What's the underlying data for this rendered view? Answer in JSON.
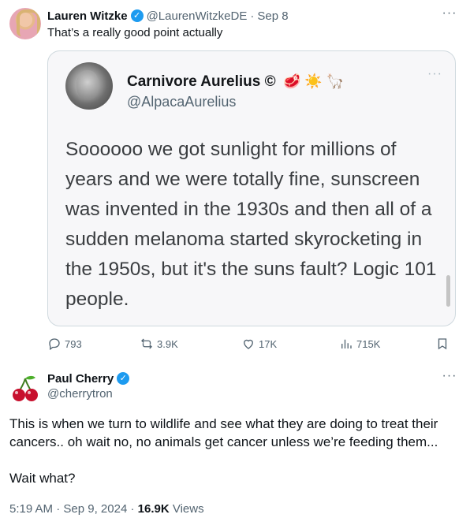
{
  "reply": {
    "author_name": "Lauren Witzke",
    "author_handle": "@LaurenWitzkeDE",
    "date": "Sep 8",
    "text": "That’s a really good point actually",
    "quote": {
      "name": "Carnivore Aurelius ©",
      "emojis": "🥩 ☀️ 🦙",
      "handle": "@AlpacaAurelius",
      "body": "Soooooo we got sunlight for millions of years and we were totally fine, sunscreen was invented in the 1930s and then all of a sudden melanoma started skyrocketing in the 1950s, but it's the suns fault? Logic 101 people."
    },
    "actions": {
      "replies": "793",
      "reposts": "3.9K",
      "likes": "17K",
      "views": "715K"
    }
  },
  "main": {
    "author_name": "Paul Cherry",
    "author_handle": "@cherrytron",
    "avatar_emoji": "🍒",
    "text_p1": "This is when we turn to wildlife and see what they are doing to treat their cancers.. oh wait no, no animals get cancer unless we’re feeding them...",
    "text_p2": "Wait what?",
    "time": "5:19 AM",
    "date": "Sep 9, 2024",
    "views_count": "16.9K",
    "views_label": "Views"
  },
  "colors": {
    "verified": "#1d9bf0",
    "secondary_text": "#536471",
    "border": "#cfd9de"
  },
  "icons": [
    "verified-badge-icon",
    "more-icon",
    "reply-icon",
    "repost-icon",
    "like-icon",
    "views-icon",
    "bookmark-icon"
  ]
}
